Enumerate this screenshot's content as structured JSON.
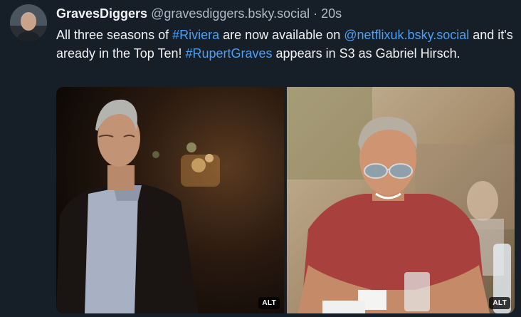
{
  "post": {
    "display_name": "GravesDiggers",
    "handle": "@gravesdiggers.bsky.social",
    "separator": "·",
    "time": "20s",
    "text_parts": {
      "p1": "All three seasons of ",
      "hashtag1": "#Riviera",
      "p2": " are now available on ",
      "mention": "@netflixuk.bsky.social",
      "p3": " and it's aready in the Top Ten! ",
      "hashtag2": "#RupertGraves",
      "p4": " appears in S3 as Gabriel Hirsch."
    },
    "images": [
      {
        "alt_badge": "ALT"
      },
      {
        "alt_badge": "ALT"
      }
    ]
  },
  "colors": {
    "background": "#161e27",
    "link": "#4b9ff5",
    "muted": "#aebbc9"
  }
}
